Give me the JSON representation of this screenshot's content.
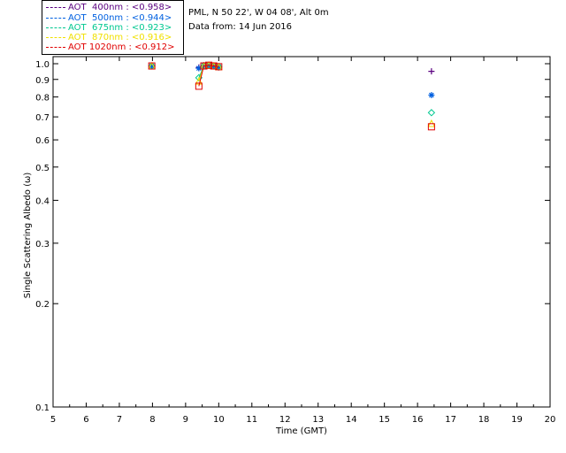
{
  "header": {
    "location": "PML, N 50 22', W 04 08', Alt 0m",
    "date": "Data from: 14 Jun 2016"
  },
  "chart_data": {
    "type": "scatter",
    "xlabel": "Time (GMT)",
    "ylabel": "Single Scattering Albedo (ω)",
    "xlim": [
      5,
      20
    ],
    "ylim": [
      0.1,
      1.0
    ],
    "yscale": "log",
    "x_ticks": [
      5,
      6,
      7,
      8,
      9,
      10,
      11,
      12,
      13,
      14,
      15,
      16,
      17,
      18,
      19,
      20
    ],
    "y_ticks": [
      {
        "value": 1.0,
        "label": "1.0"
      },
      {
        "value": 0.9,
        "label": "0.9"
      },
      {
        "value": 0.8,
        "label": "0.8"
      },
      {
        "value": 0.7,
        "label": "0.7"
      },
      {
        "value": 0.6,
        "label": "0.6"
      },
      {
        "value": 0.5,
        "label": "0.5"
      },
      {
        "value": 0.4,
        "label": "0.4"
      },
      {
        "value": 0.3,
        "label": "0.3"
      },
      {
        "value": 0.2,
        "label": "0.2"
      },
      {
        "value": 0.1,
        "label": "0.1"
      }
    ],
    "grid": false,
    "legend_position": "top-left, above plot",
    "series": [
      {
        "name": "AOT  400nm : <0.958>",
        "color": "#5a0080",
        "marker": "plus",
        "x": [
          7.98,
          9.4,
          9.55,
          9.7,
          9.85,
          10.0,
          16.42
        ],
        "y": [
          0.985,
          0.975,
          0.99,
          0.99,
          0.985,
          0.975,
          0.95
        ]
      },
      {
        "name": "AOT  500nm : <0.944>",
        "color": "#0060e0",
        "marker": "asterisk",
        "x": [
          7.98,
          9.4,
          9.55,
          9.7,
          9.85,
          10.0,
          16.42
        ],
        "y": [
          0.985,
          0.97,
          0.99,
          0.99,
          0.985,
          0.98,
          0.81
        ]
      },
      {
        "name": "AOT  675nm : <0.923>",
        "color": "#00c890",
        "marker": "diamond",
        "x": [
          7.98,
          9.4,
          9.55,
          9.7,
          9.85,
          10.0,
          16.42
        ],
        "y": [
          0.985,
          0.91,
          0.985,
          0.99,
          0.985,
          0.98,
          0.72
        ]
      },
      {
        "name": "AOT  870nm : <0.916>",
        "color": "#f0e000",
        "marker": "triangle",
        "x": [
          7.98,
          9.4,
          9.55,
          9.7,
          9.85,
          10.0,
          16.42
        ],
        "y": [
          0.985,
          0.89,
          0.985,
          0.99,
          0.985,
          0.98,
          0.67
        ]
      },
      {
        "name": "AOT 1020nm : <0.912>",
        "color": "#e00000",
        "marker": "square",
        "x": [
          7.98,
          9.4,
          9.55,
          9.7,
          9.85,
          10.0,
          16.42
        ],
        "y": [
          0.985,
          0.86,
          0.985,
          0.99,
          0.985,
          0.98,
          0.655
        ]
      }
    ]
  }
}
